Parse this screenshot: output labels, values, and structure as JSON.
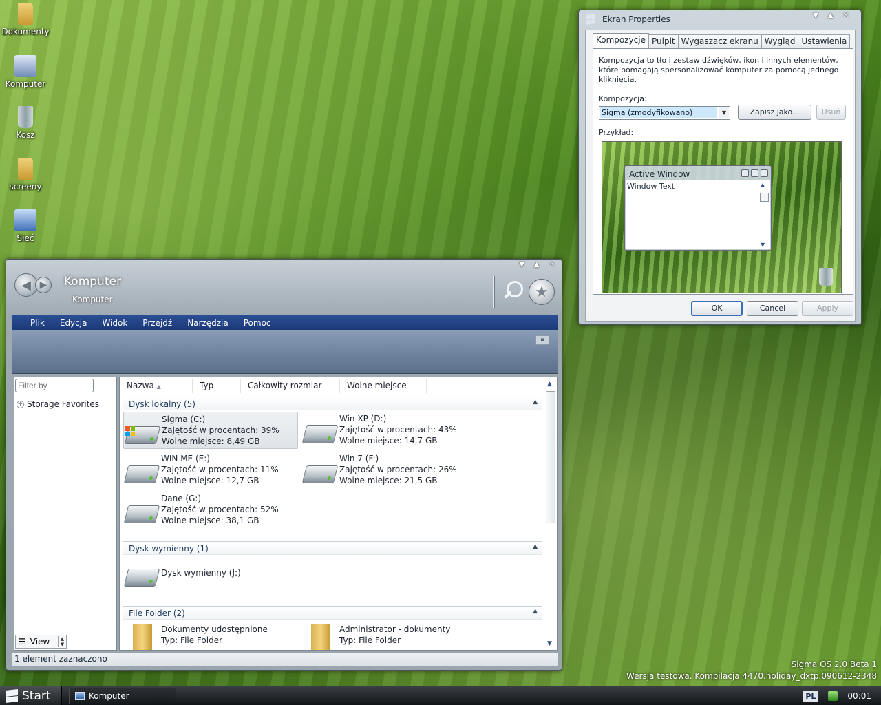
{
  "desktop": {
    "icons": [
      {
        "label": "Dokumenty",
        "icon": "folder-icon"
      },
      {
        "label": "Komputer",
        "icon": "computer-icon"
      },
      {
        "label": "Kosz",
        "icon": "recycle-bin-icon"
      },
      {
        "label": "screeny",
        "icon": "folder-icon"
      },
      {
        "label": "Sieć",
        "icon": "network-icon"
      }
    ],
    "watermark": {
      "line1": "Sigma OS 2.0 Beta 1",
      "line2": "Wersja testowa. Kompilacja 4470.holiday_dxtp.090612-2348"
    }
  },
  "taskbar": {
    "start_label": "Start",
    "task_item": "Komputer",
    "language": "PL",
    "clock": "00:01"
  },
  "explorer": {
    "title": "Komputer",
    "subtitle": "Komputer",
    "window_controls": [
      "▼",
      "▲",
      "✕"
    ],
    "menu": [
      "Plik",
      "Edycja",
      "Widok",
      "Przejdź",
      "Narzędzia",
      "Pomoc"
    ],
    "filter_placeholder": "Filter by",
    "storage_favorites": "Storage Favorites",
    "view_label": "View",
    "columns": [
      "Nazwa",
      "Typ",
      "Całkowity rozmiar",
      "Wolne miejsce"
    ],
    "groups": {
      "local": {
        "title": "Dysk lokalny (5)",
        "drives": [
          {
            "name": "Sigma (C:)",
            "usage": "Zajętość w procentach: 39%",
            "free": "Wolne miejsce: 8,49 GB",
            "selected": true
          },
          {
            "name": "Win XP (D:)",
            "usage": "Zajętość w procentach: 43%",
            "free": "Wolne miejsce: 14,7 GB"
          },
          {
            "name": "WIN ME (E:)",
            "usage": "Zajętość w procentach: 11%",
            "free": "Wolne miejsce: 12,7 GB"
          },
          {
            "name": "Win 7 (F:)",
            "usage": "Zajętość w procentach: 26%",
            "free": "Wolne miejsce: 21,5 GB"
          },
          {
            "name": "Dane (G:)",
            "usage": "Zajętość w procentach: 52%",
            "free": "Wolne miejsce: 38,1 GB"
          }
        ]
      },
      "removable": {
        "title": "Dysk wymienny (1)",
        "drives": [
          {
            "name": "Dysk wymienny (J:)"
          }
        ]
      },
      "folders": {
        "title": "File Folder (2)",
        "items": [
          {
            "name": "Dokumenty udostępnione",
            "type": "Typ: File Folder"
          },
          {
            "name": "Administrator - dokumenty",
            "type": "Typ: File Folder"
          }
        ]
      }
    },
    "status": "1 element zaznaczono"
  },
  "properties": {
    "title": "Ekran Properties",
    "tabs": [
      "Kompozycje",
      "Pulpit",
      "Wygaszacz ekranu",
      "Wygląd",
      "Ustawienia"
    ],
    "description": "Kompozycja to tło i zestaw dźwięków, ikon i innych elementów, które pomagają spersonalizować komputer za pomocą jednego kliknięcia.",
    "theme_label": "Kompozycja:",
    "theme_value": "Sigma (zmodyfikowano)",
    "save_as": "Zapisz jako...",
    "delete": "Usuń",
    "sample_label": "Przykład:",
    "preview": {
      "window_title": "Active Window",
      "window_text": "Window Text"
    },
    "ok": "OK",
    "cancel": "Cancel",
    "apply": "Apply"
  },
  "colors": {
    "menubar": "#1c3a78",
    "accent": "#3a6fb5",
    "selected_combo": "#cde8fb"
  }
}
